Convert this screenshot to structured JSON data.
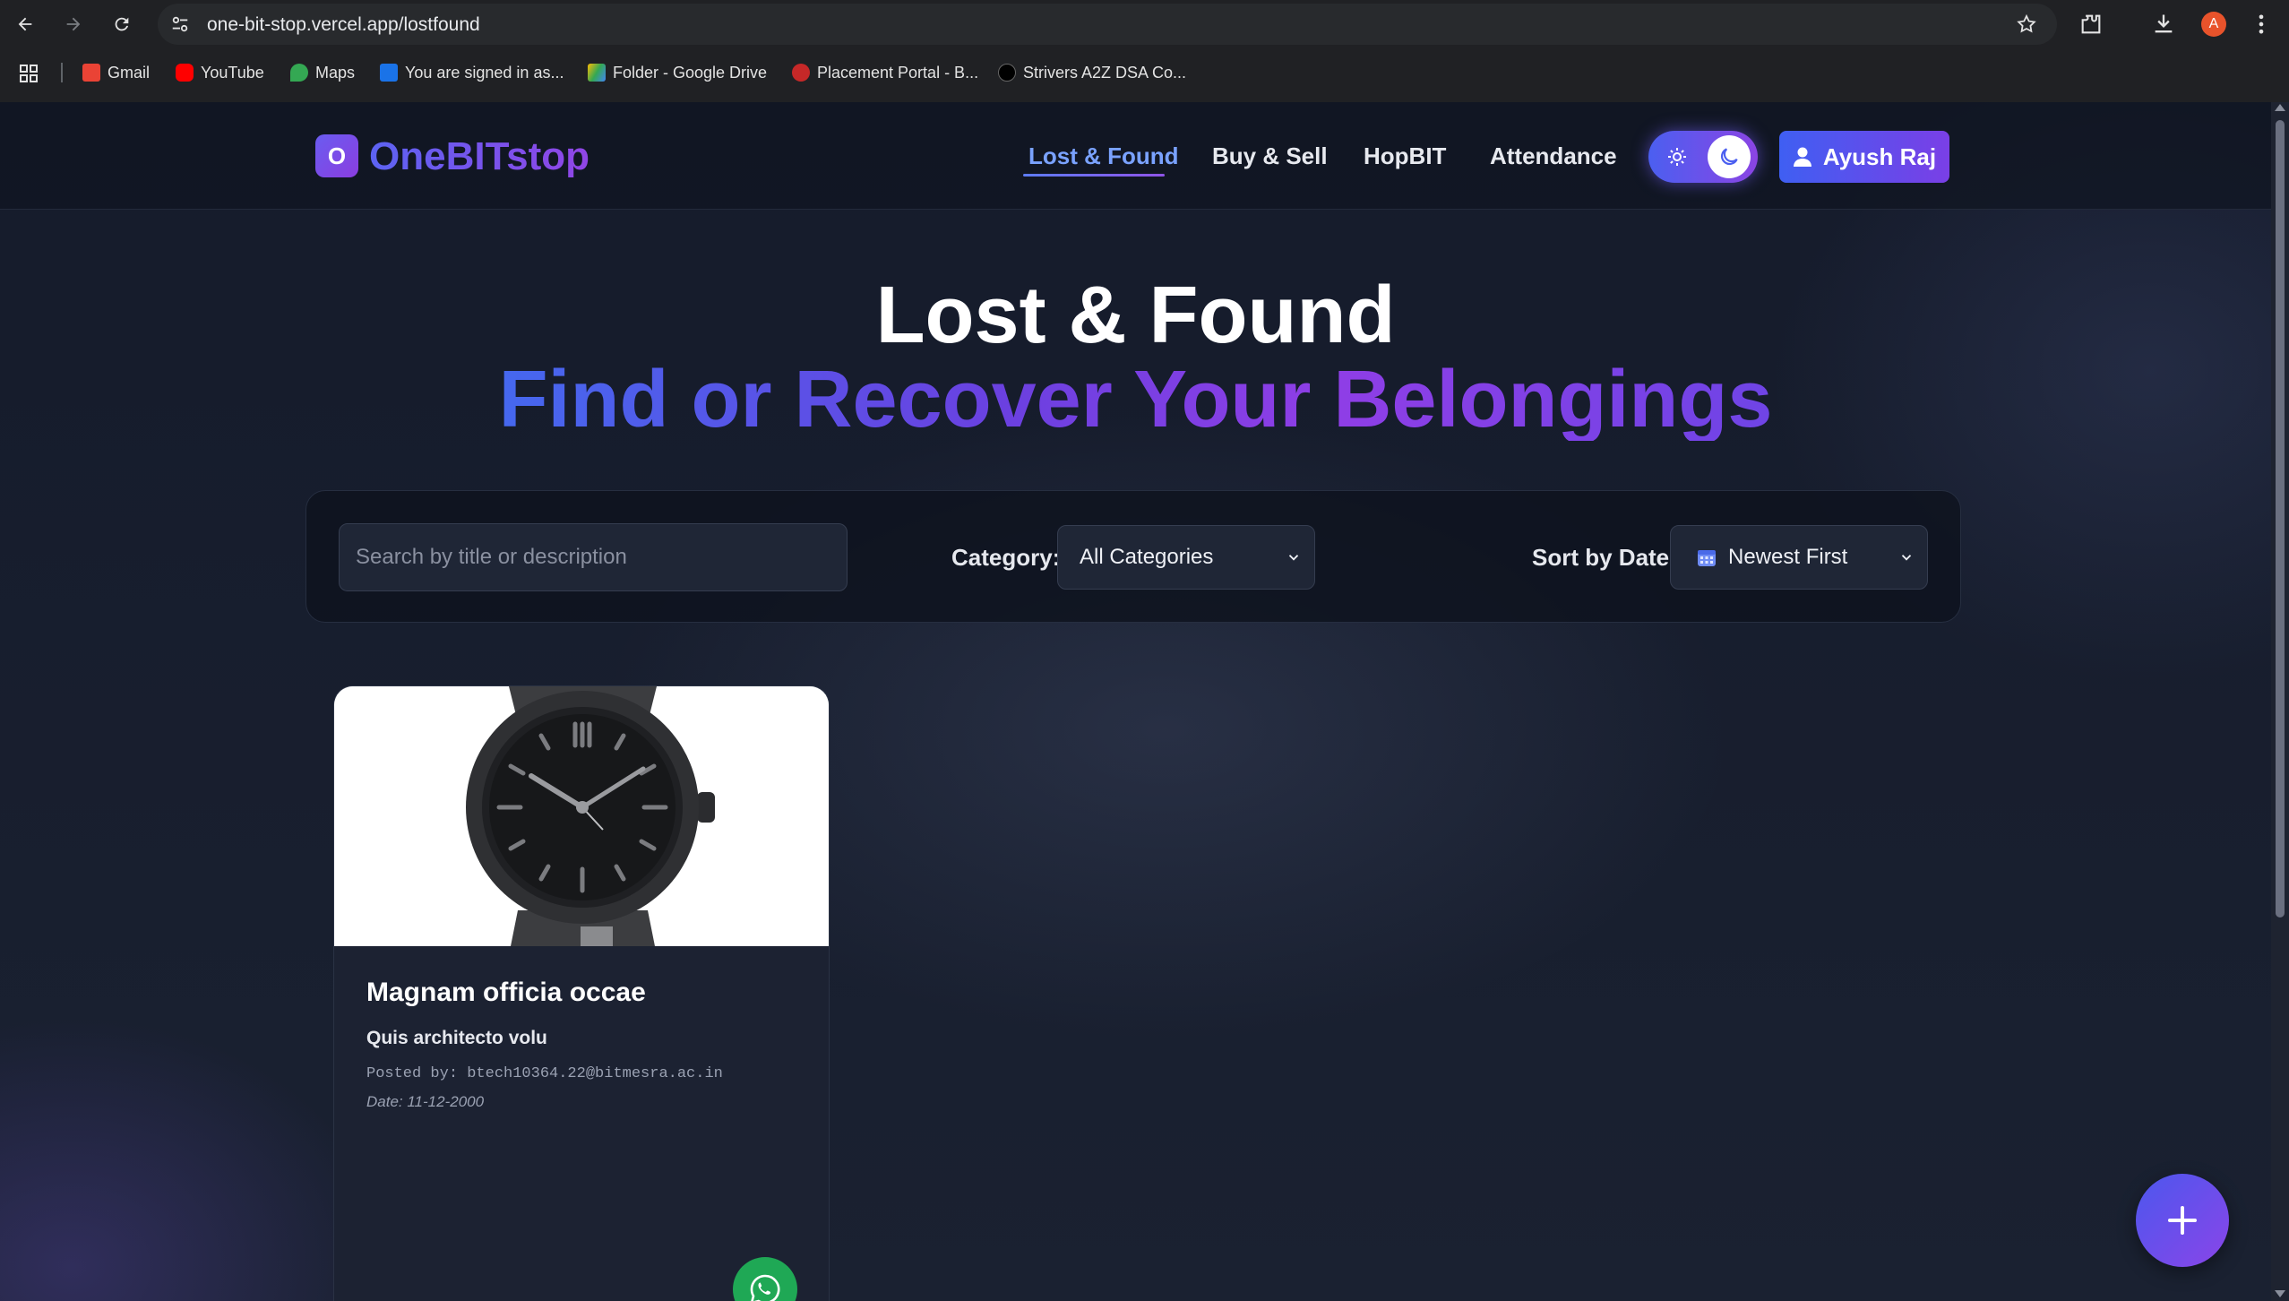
{
  "browser": {
    "url": "one-bit-stop.vercel.app/lostfound",
    "profile_initial": "A",
    "bookmarks": [
      {
        "label": "Gmail",
        "icon": "gmail-icon",
        "color": "#ea4335"
      },
      {
        "label": "YouTube",
        "icon": "youtube-icon",
        "color": "#ff0000"
      },
      {
        "label": "Maps",
        "icon": "maps-icon",
        "color": "#34a853"
      },
      {
        "label": "You are signed in as...",
        "icon": "s-icon",
        "color": "#1a73e8"
      },
      {
        "label": "Folder - Google Drive",
        "icon": "drive-icon",
        "color": "#fbbc04"
      },
      {
        "label": "Placement Portal - B...",
        "icon": "portal-icon",
        "color": "#c62828"
      },
      {
        "label": "Strivers A2Z DSA Co...",
        "icon": "tuf-icon",
        "color": "#000000"
      }
    ]
  },
  "nav": {
    "logo_letter": "O",
    "brand": "OneBITstop",
    "links": [
      "Lost & Found",
      "Buy & Sell",
      "HopBIT",
      "Attendance"
    ],
    "active_link": "Lost & Found",
    "user_name": "Ayush Raj"
  },
  "hero": {
    "title": "Lost & Found",
    "subtitle": "Find or Recover Your Belongings"
  },
  "filters": {
    "search_placeholder": "Search by title or description",
    "category_label": "Category:",
    "category_value": "All Categories",
    "sort_label": "Sort by Date:",
    "sort_value": "Newest First"
  },
  "items": [
    {
      "title": "Magnam officia occae",
      "description": "Quis architecto volu",
      "posted_by": "Posted by: btech10364.22@bitmesra.ac.in",
      "date": "Date: 11-12-2000",
      "image": "watch-image"
    }
  ],
  "colors": {
    "accent_blue": "#4568ef",
    "accent_purple": "#8f3ee6",
    "whatsapp": "#1fa855",
    "background": "#151b2b"
  }
}
